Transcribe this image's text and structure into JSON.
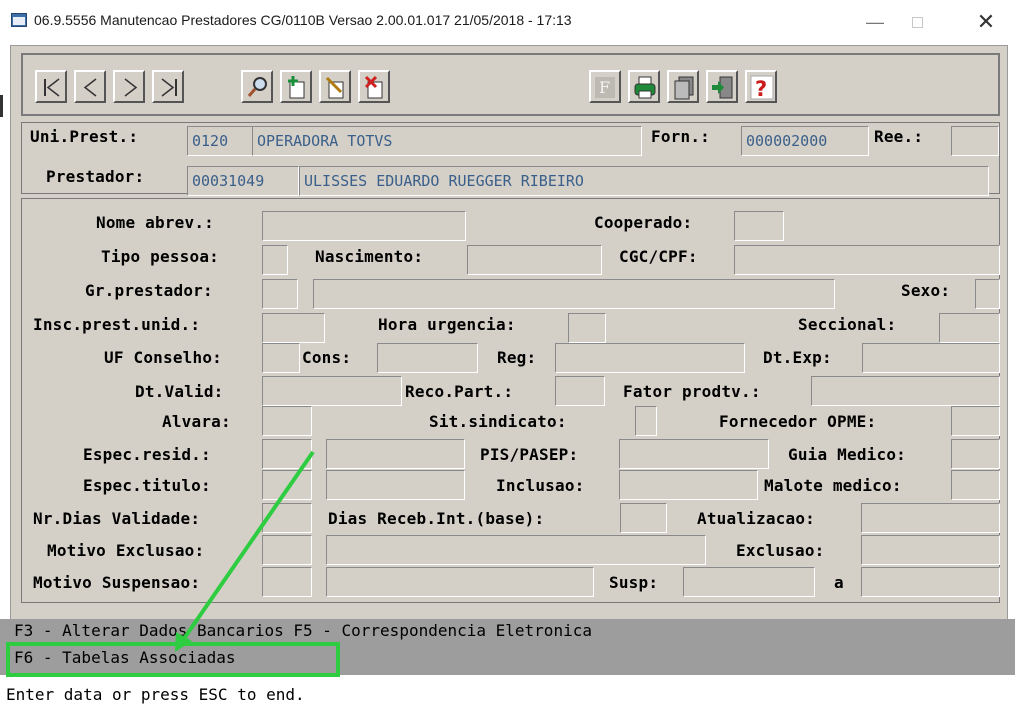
{
  "window": {
    "title": "06.9.5556 Manutencao  Prestadores CG/0110B Versao 2.00.01.017 21/05/2018 - 17:13",
    "minimize": "—",
    "close": "✕"
  },
  "toolbar": {
    "buttons": [
      "first-record-icon",
      "previous-record-icon",
      "next-record-icon",
      "last-record-icon",
      "search-icon",
      "add-record-icon",
      "edit-record-icon",
      "delete-record-icon",
      "filter-icon",
      "print-icon",
      "copy-icon",
      "exit-icon",
      "help-icon"
    ]
  },
  "header": {
    "uni_prest_label": "Uni.Prest.:",
    "uni_prest_code": "0120",
    "uni_prest_name": "OPERADORA TOTVS",
    "forn_label": "Forn.:",
    "forn_value": "000002000",
    "ree_label": "Ree.:",
    "ree_value": "",
    "prestador_label": "Prestador:",
    "prestador_code": "00031049",
    "prestador_name": "ULISSES EDUARDO RUEGGER RIBEIRO"
  },
  "form": {
    "nome_abrev": "Nome abrev.:",
    "cooperado": "Cooperado:",
    "tipo_pessoa": "Tipo pessoa:",
    "nascimento": "Nascimento:",
    "cgc_cpf": "CGC/CPF:",
    "gr_prestador": "Gr.prestador:",
    "sexo": "Sexo:",
    "insc_prest_unid": "Insc.prest.unid.:",
    "hora_urgencia": "Hora urgencia:",
    "seccional": "Seccional:",
    "uf_conselho": "UF Conselho:",
    "cons": "Cons:",
    "reg": "Reg:",
    "dt_exp": "Dt.Exp:",
    "dt_valid": "Dt.Valid:",
    "reco_part": "Reco.Part.:",
    "fator_prodtv": "Fator prodtv.:",
    "alvara": "Alvara:",
    "sit_sindicato": "Sit.sindicato:",
    "fornecedor_opme": "Fornecedor OPME:",
    "espec_resid": "Espec.resid.:",
    "pis_pasep": "PIS/PASEP:",
    "guia_medico": "Guia Medico:",
    "espec_titulo": "Espec.titulo:",
    "inclusao": "Inclusao:",
    "malote_medico": "Malote medico:",
    "nr_dias_validade": "Nr.Dias Validade:",
    "dias_receb_int": "Dias Receb.Int.(base):",
    "atualizacao": "Atualizacao:",
    "motivo_exclusao": "Motivo Exclusao:",
    "exclusao": "Exclusao:",
    "motivo_suspensao": "Motivo Suspensao:",
    "susp": "Susp:",
    "a": "a"
  },
  "fkeys": {
    "line1": "F3 - Alterar Dados Bancarios  F5 - Correspondencia Eletronica",
    "line2": "F6 - Tabelas Associadas"
  },
  "status": "Enter data or press ESC to end.",
  "colors": {
    "highlight": "#2ecc40",
    "frame": "#d4d0c8",
    "fkey_bar": "#9d9d9d",
    "field_text": "#2f5e93"
  }
}
